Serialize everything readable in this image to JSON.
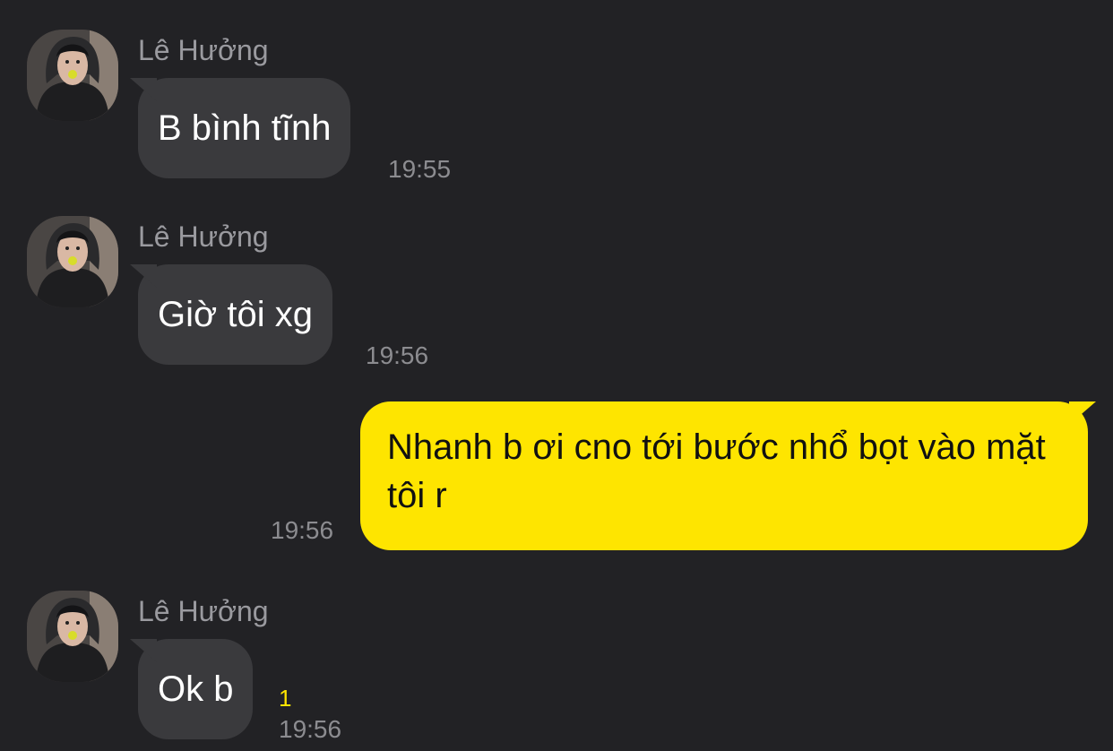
{
  "messages": [
    {
      "sender": "Lê Hưởng",
      "text": "B bình tĩnh",
      "time": "19:55"
    },
    {
      "sender": "Lê Hưởng",
      "text": "Giờ tôi xg",
      "time": "19:56"
    },
    {
      "text": "Nhanh b ơi cno tới bước nhổ bọt vào mặt tôi r",
      "time": "19:56"
    },
    {
      "sender": "Lê Hưởng",
      "text": "Ok b",
      "time": "19:56",
      "unread": "1"
    }
  ],
  "colors": {
    "background": "#222225",
    "incoming_bubble": "#3a3a3d",
    "outgoing_bubble": "#fee500",
    "unread_count": "#fee500"
  },
  "icons": {
    "avatar": "profile-photo"
  }
}
